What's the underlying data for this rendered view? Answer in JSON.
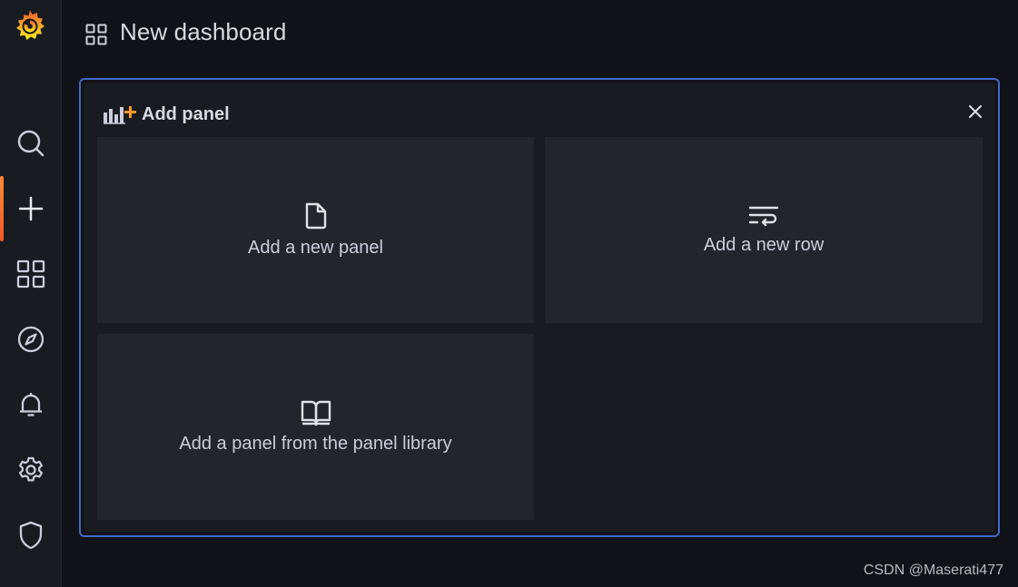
{
  "sidebar": {
    "items": [
      {
        "name": "search",
        "icon": "search-icon"
      },
      {
        "name": "create",
        "icon": "plus-icon",
        "active": true
      },
      {
        "name": "dashboards",
        "icon": "apps-icon"
      },
      {
        "name": "explore",
        "icon": "compass-icon"
      },
      {
        "name": "alerting",
        "icon": "bell-icon"
      },
      {
        "name": "configuration",
        "icon": "gear-icon"
      },
      {
        "name": "server-admin",
        "icon": "shield-icon"
      }
    ]
  },
  "header": {
    "title": "New dashboard"
  },
  "add_panel": {
    "title": "Add panel",
    "options": {
      "new_panel": "Add a new panel",
      "new_row": "Add a new row",
      "library": "Add a panel from the panel library"
    }
  },
  "watermark": "CSDN @Maserati477",
  "colors": {
    "accent_orange": "#f05a28",
    "panel_border": "#3e6ac8",
    "background": "#111217",
    "card": "#22252b"
  }
}
